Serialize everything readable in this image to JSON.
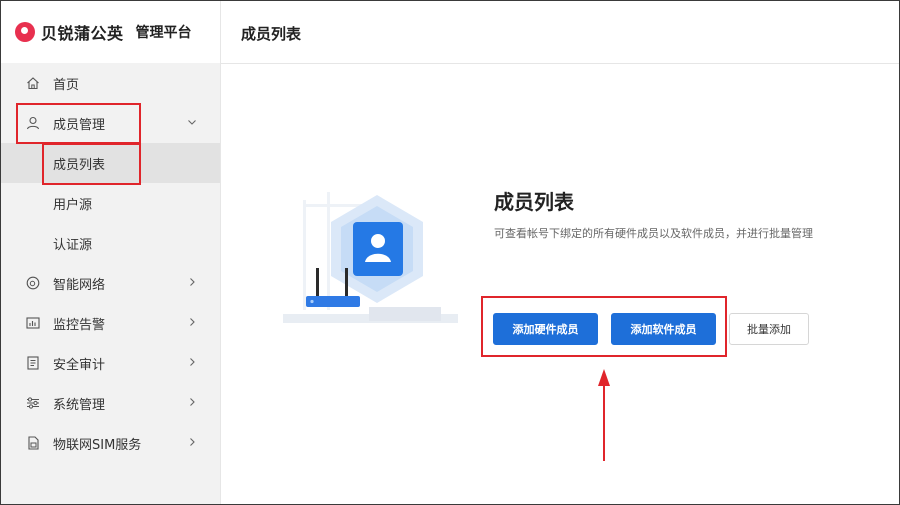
{
  "brand": {
    "name": "贝锐蒲公英",
    "subtitle": "管理平台"
  },
  "sidebar": {
    "items": [
      {
        "label": "首页",
        "icon": "home-icon"
      },
      {
        "label": "成员管理",
        "icon": "user-icon",
        "expanded": true
      },
      {
        "label": "智能网络",
        "icon": "network-icon"
      },
      {
        "label": "监控告警",
        "icon": "monitor-icon"
      },
      {
        "label": "安全审计",
        "icon": "audit-icon"
      },
      {
        "label": "系统管理",
        "icon": "settings-icon"
      },
      {
        "label": "物联网SIM服务",
        "icon": "sim-icon"
      }
    ],
    "sub_items": [
      {
        "label": "成员列表",
        "active": true
      },
      {
        "label": "用户源"
      },
      {
        "label": "认证源"
      }
    ]
  },
  "header": {
    "title": "成员列表"
  },
  "main": {
    "title": "成员列表",
    "description": "可查看帐号下绑定的所有硬件成员以及软件成员，并进行批量管理",
    "buttons": {
      "add_hardware": "添加硬件成员",
      "add_software": "添加软件成员",
      "batch_add": "批量添加"
    }
  },
  "colors": {
    "primary": "#1e6fd9",
    "annotation": "#e0252b",
    "brand": "#e8304f"
  }
}
